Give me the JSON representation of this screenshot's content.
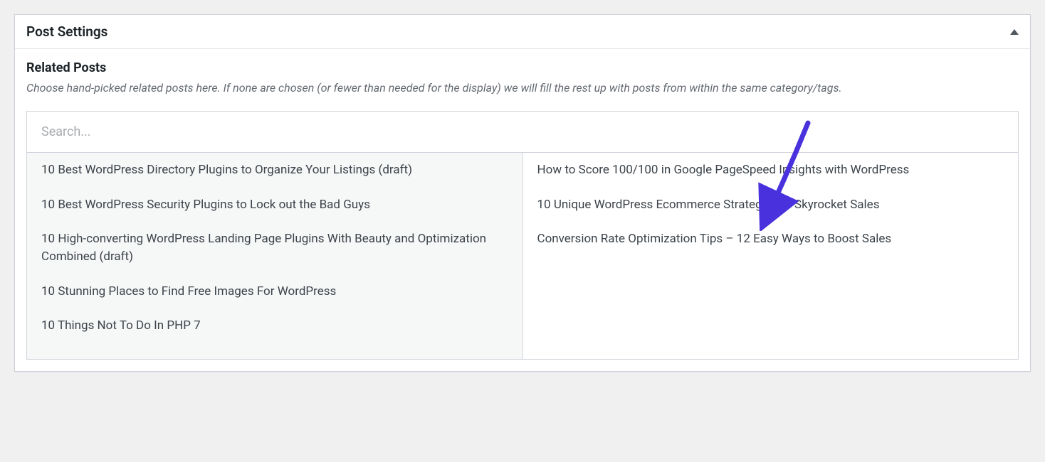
{
  "metabox": {
    "title": "Post Settings"
  },
  "section": {
    "title": "Related Posts",
    "description": "Choose hand-picked related posts here. If none are chosen (or fewer than needed for the display) we will fill the rest up with posts from within the same category/tags."
  },
  "search": {
    "placeholder": "Search..."
  },
  "available_posts": [
    "10 Best WordPress Directory Plugins to Organize Your Listings (draft)",
    "10 Best WordPress Security Plugins to Lock out the Bad Guys",
    "10 High-converting WordPress Landing Page Plugins With Beauty and Optimization Combined (draft)",
    "10 Stunning Places to Find Free Images For WordPress",
    "10 Things Not To Do In PHP 7"
  ],
  "selected_posts": [
    "How to Score 100/100 in Google PageSpeed Insights with WordPress",
    "10 Unique WordPress Ecommerce Strategies to Skyrocket Sales",
    "Conversion Rate Optimization Tips – 12 Easy Ways to Boost Sales"
  ],
  "annotation": {
    "arrow_color": "#4931de"
  }
}
